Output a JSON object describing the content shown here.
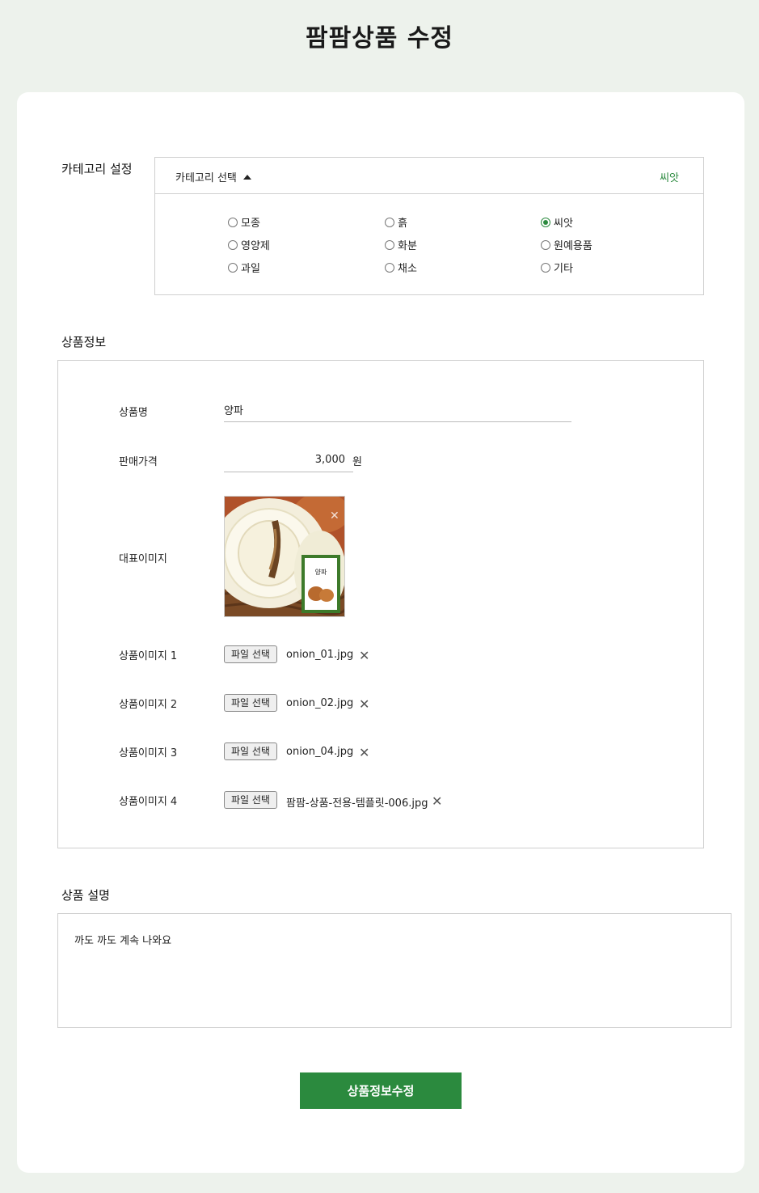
{
  "page": {
    "title": "팜팜상품 수정"
  },
  "category": {
    "section_label": "카테고리 설정",
    "toggle_label": "카테고리 선택",
    "selected_value": "씨앗",
    "options": [
      "모종",
      "흙",
      "씨앗",
      "영양제",
      "화분",
      "원예용품",
      "과일",
      "채소",
      "기타"
    ],
    "checked": "씨앗"
  },
  "product_info": {
    "section_label": "상품정보",
    "name_label": "상품명",
    "name_value": "양파",
    "price_label": "판매가격",
    "price_value": "3,000",
    "price_unit": "원",
    "main_image_label": "대표이미지",
    "main_image_product_label": "양파",
    "file_button_label": "파일 선택",
    "images": [
      {
        "label": "상품이미지 1",
        "file_name": "onion_01.jpg"
      },
      {
        "label": "상품이미지 2",
        "file_name": "onion_02.jpg"
      },
      {
        "label": "상품이미지 3",
        "file_name": "onion_04.jpg"
      },
      {
        "label": "상품이미지 4",
        "file_name": "팜팜-상품-전용-템플릿-006.jpg"
      }
    ]
  },
  "description": {
    "section_label": "상품 설명",
    "value": "까도 까도 계속 나와요"
  },
  "submit": {
    "label": "상품정보수정"
  },
  "colors": {
    "accent": "#2b8a3e",
    "background": "#edf2ec"
  }
}
